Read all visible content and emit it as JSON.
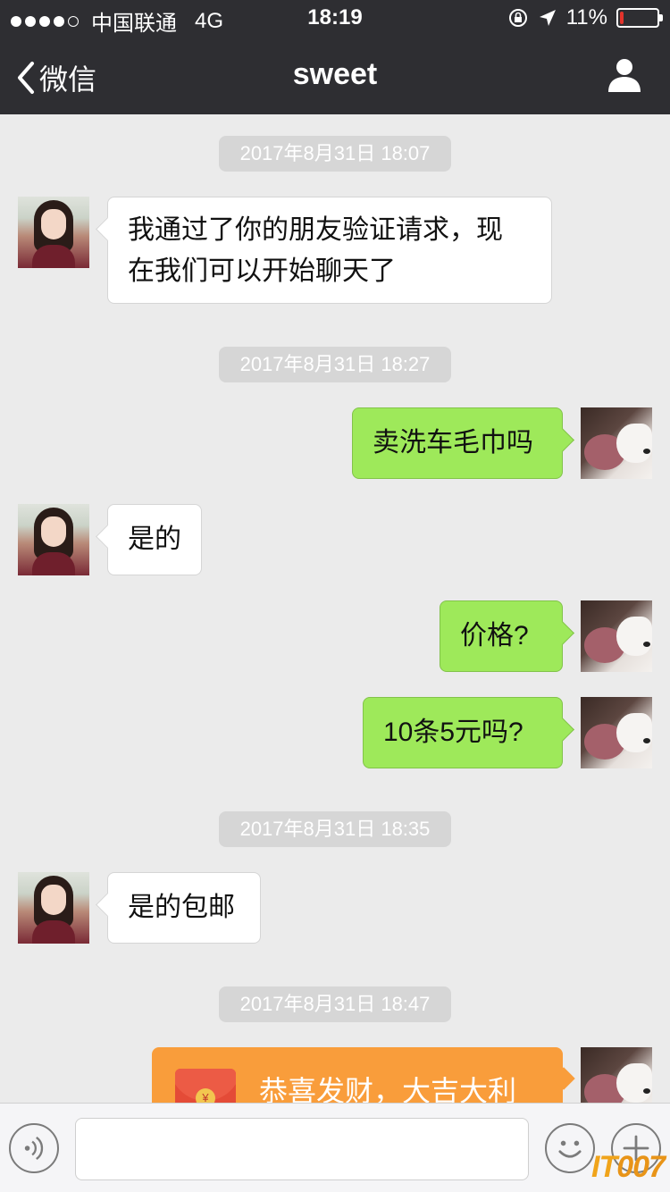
{
  "status_bar": {
    "carrier": "中国联通",
    "network": "4G",
    "time": "18:19",
    "battery": "11%",
    "battery_level": 0.11
  },
  "nav": {
    "back_label": "微信",
    "title": "sweet",
    "profile_icon": "person-icon"
  },
  "messages": [
    {
      "type": "timestamp",
      "text": "2017年8月31日 18:07"
    },
    {
      "type": "message",
      "side": "left",
      "text_lines": [
        "我通过了你的朋友验证请求，现",
        "在我们可以开始聊天了"
      ]
    },
    {
      "type": "timestamp",
      "text": "2017年8月31日 18:27"
    },
    {
      "type": "message",
      "side": "right",
      "text": "卖洗车毛巾吗"
    },
    {
      "type": "message",
      "side": "left",
      "text": "是的"
    },
    {
      "type": "message",
      "side": "right",
      "text": "价格?"
    },
    {
      "type": "message",
      "side": "right",
      "text": "10条5元吗?"
    },
    {
      "type": "timestamp",
      "text": "2017年8月31日 18:35"
    },
    {
      "type": "message",
      "side": "left",
      "text": "是的包邮"
    },
    {
      "type": "timestamp",
      "text": "2017年8月31日 18:47"
    },
    {
      "type": "red_packet",
      "side": "right",
      "text": "恭喜发财，大吉大利",
      "coin_symbol": "¥"
    }
  ],
  "input_bar": {
    "voice_icon": "voice-icon",
    "emoji_icon": "emoji-icon",
    "plus_icon": "plus-icon"
  },
  "watermark": {
    "text": "IT007",
    "prefix": "IT",
    "suffix": "007"
  },
  "colors": {
    "nav_bg": "#2e2e32",
    "chat_bg": "#ebebeb",
    "bubble_left": "#ffffff",
    "bubble_right": "#9ee95a",
    "red_packet": "#f99d3b",
    "battery_low": "#e2332b"
  }
}
